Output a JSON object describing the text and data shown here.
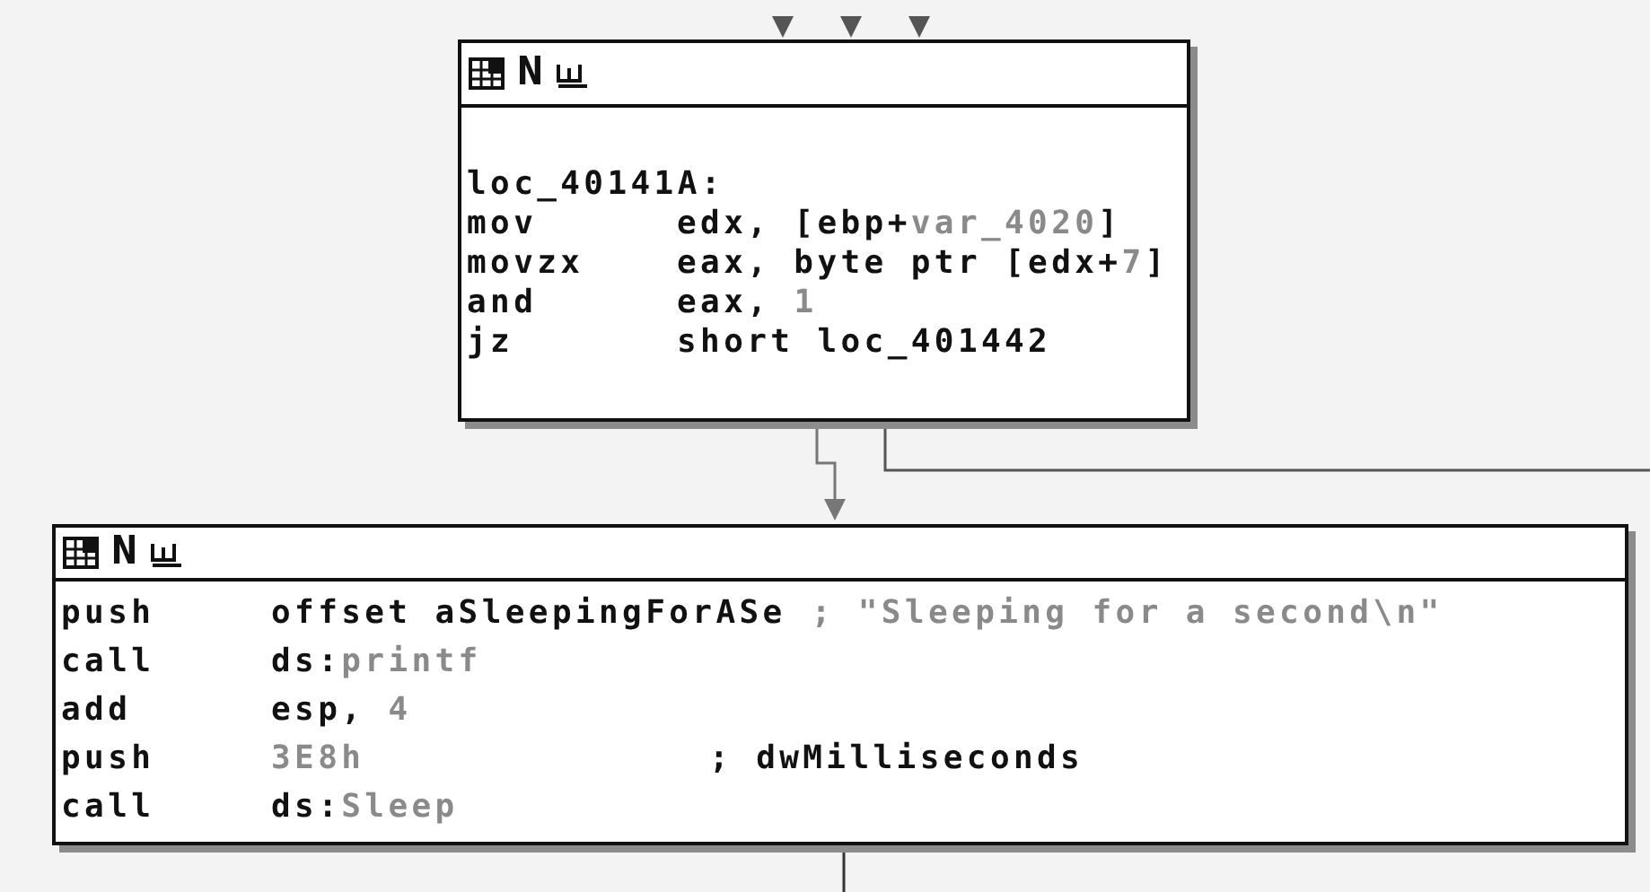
{
  "graph": {
    "nodes": [
      {
        "header_button": "N",
        "label": "loc_40141A:",
        "lines": [
          {
            "mnemonic": "mov",
            "operand": [
              {
                "text": "edx, [ebp+",
                "kind": "plain"
              },
              {
                "text": "var_4020",
                "kind": "name"
              },
              {
                "text": "]",
                "kind": "plain"
              }
            ]
          },
          {
            "mnemonic": "movzx",
            "operand": [
              {
                "text": "eax, byte ptr [edx+",
                "kind": "plain"
              },
              {
                "text": "7",
                "kind": "number"
              },
              {
                "text": "]",
                "kind": "plain"
              }
            ]
          },
          {
            "mnemonic": "and",
            "operand": [
              {
                "text": "eax, ",
                "kind": "plain"
              },
              {
                "text": "1",
                "kind": "number"
              }
            ]
          },
          {
            "mnemonic": "jz",
            "operand": [
              {
                "text": "short loc_401442",
                "kind": "plain"
              }
            ]
          }
        ]
      },
      {
        "header_button": "N",
        "lines": [
          {
            "mnemonic": "push",
            "operand": [
              {
                "text": "offset aSleepingForASe",
                "kind": "plain"
              }
            ],
            "comment": [
              {
                "text": "; \"Sleeping for a second\\n\"",
                "kind": "string"
              }
            ]
          },
          {
            "mnemonic": "call",
            "operand": [
              {
                "text": "ds:",
                "kind": "plain"
              },
              {
                "text": "printf",
                "kind": "name"
              }
            ]
          },
          {
            "mnemonic": "add",
            "operand": [
              {
                "text": "esp, ",
                "kind": "plain"
              },
              {
                "text": "4",
                "kind": "number"
              }
            ]
          },
          {
            "mnemonic": "push",
            "operand": [
              {
                "text": "3E8h",
                "kind": "number"
              }
            ],
            "comment": [
              {
                "text": "; dwMilliseconds",
                "kind": "plain"
              }
            ]
          },
          {
            "mnemonic": "call",
            "operand": [
              {
                "text": "ds:",
                "kind": "plain"
              },
              {
                "text": "Sleep",
                "kind": "name"
              }
            ]
          }
        ]
      }
    ]
  }
}
